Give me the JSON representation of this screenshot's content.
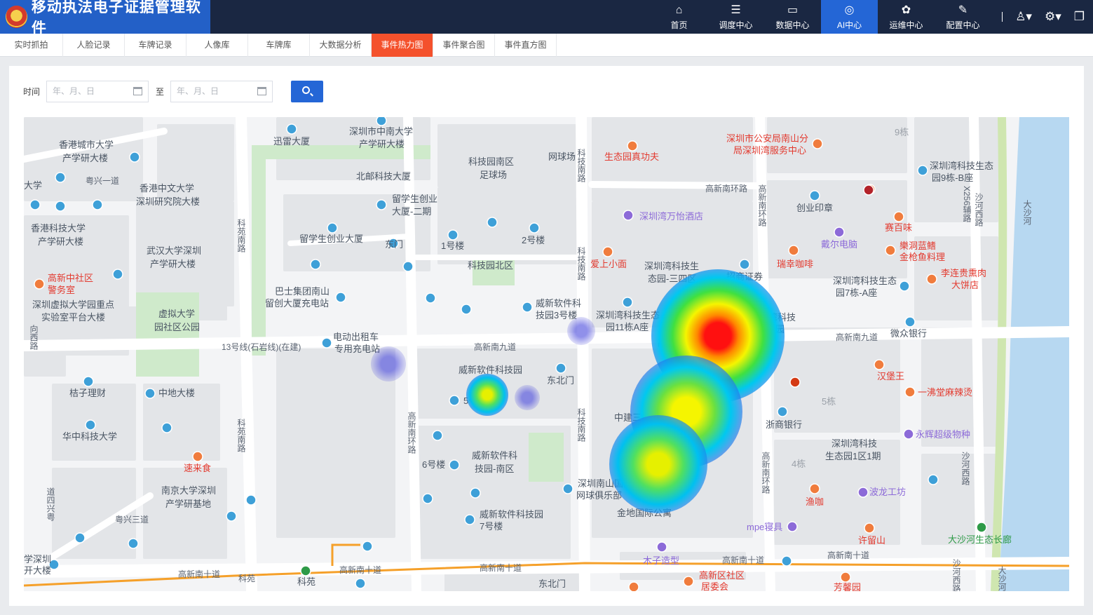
{
  "app": {
    "title": "移动执法电子证据管理软件"
  },
  "nav": [
    {
      "label": "首页",
      "icon": "home-icon",
      "glyph": "⌂",
      "active": false
    },
    {
      "label": "调度中心",
      "icon": "sliders-icon",
      "glyph": "☰",
      "active": false
    },
    {
      "label": "数据中心",
      "icon": "monitor-icon",
      "glyph": "▭",
      "active": false
    },
    {
      "label": "AI中心",
      "icon": "ai-icon",
      "glyph": "◎",
      "active": true
    },
    {
      "label": "运维中心",
      "icon": "ops-icon",
      "glyph": "✿",
      "active": false
    },
    {
      "label": "配置中心",
      "icon": "wrench-icon",
      "glyph": "✎",
      "active": false
    }
  ],
  "tools": {
    "user_glyph": "♙▾",
    "settings_glyph": "⚙▾",
    "window_glyph": "❐"
  },
  "tabs": [
    {
      "label": "实时抓拍",
      "active": false
    },
    {
      "label": "人脸记录",
      "active": false
    },
    {
      "label": "车牌记录",
      "active": false
    },
    {
      "label": "人像库",
      "active": false
    },
    {
      "label": "车牌库",
      "active": false
    },
    {
      "label": "大数据分析",
      "active": false
    },
    {
      "label": "事件热力图",
      "active": true
    },
    {
      "label": "事件聚合图",
      "active": false
    },
    {
      "label": "事件直方图",
      "active": false
    }
  ],
  "filter": {
    "time_label": "时间",
    "to_label": "至",
    "start_placeholder": "年、月、日",
    "end_placeholder": "年、月、日"
  },
  "map": {
    "labels": {
      "poi_01": "香港城市大学",
      "poi_02": "产学研大楼",
      "poi_03": "香港中文大学",
      "poi_04": "深圳研究院大楼",
      "poi_05": "香港科技大学",
      "poi_06": "产学研大楼",
      "poi_07": "武汉大学深圳",
      "poi_08": "产学研大楼",
      "poi_09": "高新中社区",
      "poi_10": "警务室",
      "poi_11": "深圳虚拟大学园重点",
      "poi_12": "实验室平台大楼",
      "poi_13": "虚拟大学",
      "poi_14": "园社区公园",
      "poi_15": "桔子理财",
      "poi_16": "中地大楼",
      "poi_17": "华中科技大学",
      "poi_18": "速来食",
      "poi_19": "南京大学深圳",
      "poi_20": "产学研基地",
      "poi_21": "迅雷大厦",
      "poi_22": "深圳市中南大学",
      "poi_23": "产学研大楼",
      "poi_24": "北邮科技大厦",
      "poi_25": "科技园南区",
      "poi_26": "足球场",
      "poi_27": "留学生创业",
      "poi_28": "大厦-二期",
      "poi_29": "留学生创业大厦",
      "poi_30": "东门",
      "poi_31": "1号楼",
      "poi_32": "2号楼",
      "poi_33": "科技园北区",
      "poi_34": "巴士集团南山",
      "poi_35": "留创大厦充电站",
      "poi_36": "威新软件科",
      "poi_37": "技园3号楼",
      "poi_38": "电动出租车",
      "poi_39": "专用充电站",
      "poi_40": "威新软件科技园",
      "poi_41": "东北门",
      "poi_42": "5号",
      "poi_43": "6号楼",
      "poi_44": "威新软件科",
      "poi_45": "技园-南区",
      "poi_46": "威新软件科技园",
      "poi_47": "7号楼",
      "poi_48": "深圳南山国际",
      "poi_49": "网球俱乐部",
      "poi_50": "金地国际公寓",
      "poi_51": "中建三",
      "poi_52": "深圳湾科技生态",
      "poi_53": "园11栋A座",
      "poi_54": "深圳湾科技生",
      "poi_55": "态园-三四区",
      "poi_56": "深圳湾万怡酒店",
      "poi_57": "爱上小面",
      "poi_58": "生态园真功夫",
      "poi_59": "深圳市公安局南山分",
      "poi_60": "局深圳湾服务中心",
      "poi_61": "创业印章",
      "poi_62": "戴尔电脑",
      "poi_63": "瑞幸咖啡",
      "poi_64": "招商证券",
      "poi_65": "深圳湾科技",
      "poi_66": "生态园",
      "poi_67": "赛百味",
      "poi_68": "樂洞蓝鳍",
      "poi_69": "金枪鱼料理",
      "poi_70": "李连贵熏肉",
      "poi_71": "大饼店",
      "poi_72": "深圳湾科技生态",
      "poi_73": "园7栋-A座",
      "poi_74": "深圳湾科技生态",
      "poi_75": "园9栋-B座",
      "poi_76": "微众银行",
      "poi_77": "汉堡王",
      "poi_78": "一沸堂麻辣烫",
      "poi_79": "浙商银行",
      "poi_80": "永辉超级物种",
      "poi_81": "深圳湾科技",
      "poi_82": "生态园1区1期",
      "poi_83": "渔咖",
      "poi_84": "波龙工坊",
      "poi_85": "mpe寝具",
      "poi_86": "许留山",
      "poi_87": "大沙河生态长廊",
      "poi_88": "木子造型",
      "poi_89": "高新区社区",
      "poi_90": "居委会",
      "poi_91": "芳馨园",
      "poi_92": "科苑",
      "poi_93": "东北门",
      "poi_94": "大学",
      "poi_95": "学深圳",
      "poi_96": "开大楼",
      "poi_97": "网球场",
      "poi_98": "4栋",
      "poi_99": "5栋",
      "poi_100": "9栋"
    },
    "roads": {
      "r_01": "高新南九道",
      "r_02": "高新南九道",
      "r_03": "高新南十道",
      "r_04": "高新南十道",
      "r_05": "高新南十道",
      "r_06": "高新南十道",
      "r_07": "高新南十道",
      "r_08": "高新南环路",
      "r_09": "科技南路",
      "r_10": "科技南路",
      "r_11": "科技南路",
      "r_12": "科苑南路",
      "r_13": "科苑南路",
      "r_14": "高新南环路",
      "r_15": "高新南环路",
      "r_16": "高新南环路",
      "r_17": "沙河西路",
      "r_18": "沙河西路",
      "r_19": "沙河西路",
      "r_20": "大沙河",
      "r_21": "大沙河",
      "r_22": "粤兴一道",
      "r_23": "粤兴三道",
      "r_24": "道四兴粤",
      "r_25": "13号线(石岩线)(在建)",
      "r_26": "X256辅路",
      "r_27": "向西路",
      "r_28": "高新",
      "r_29": "科苑"
    },
    "colors": {
      "land": "#f3f4f6",
      "block": "#e3e5e8",
      "green": "#cfeacb",
      "water": "#b7d8f1",
      "road": "#ffffff",
      "metro": "#f5a02a",
      "poi_blue": "#3ea0d8",
      "poi_orange": "#f07c3d",
      "poi_purple": "#8c6ad8",
      "poi_red": "#e33a2f"
    }
  },
  "heatmap_data": {
    "points": [
      {
        "name": "hotspot-1",
        "intensity": 1.0
      },
      {
        "name": "hotspot-2",
        "intensity": 0.85
      },
      {
        "name": "hotspot-3",
        "intensity": 0.75
      },
      {
        "name": "hotspot-4",
        "intensity": 0.7
      },
      {
        "name": "hotspot-5",
        "intensity": 0.25
      },
      {
        "name": "hotspot-6",
        "intensity": 0.2
      },
      {
        "name": "hotspot-7",
        "intensity": 0.15
      }
    ]
  }
}
